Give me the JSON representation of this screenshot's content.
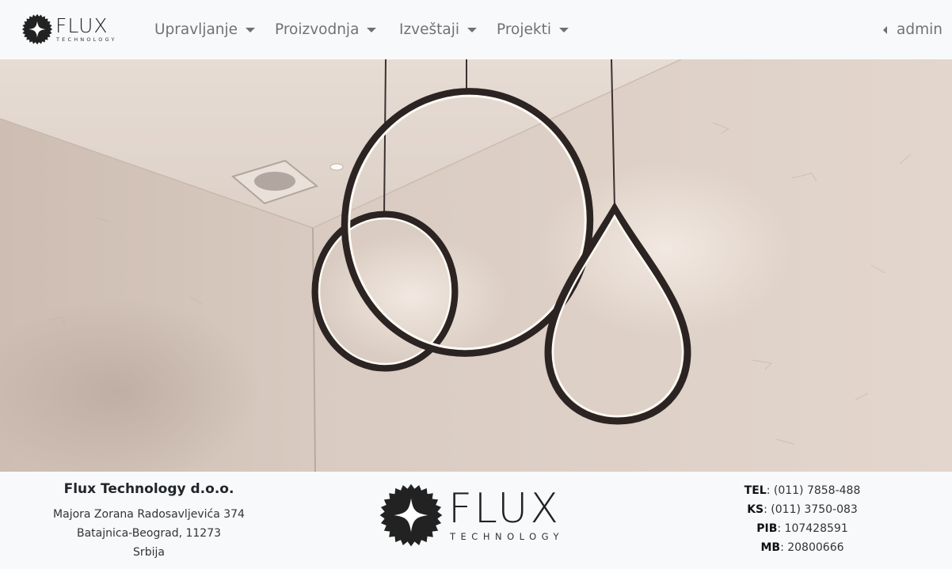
{
  "brand": {
    "name": "FLUX",
    "tagline": "TECHNOLOGY"
  },
  "nav": {
    "items": [
      {
        "label": "Upravljanje"
      },
      {
        "label": "Proizvodnja"
      },
      {
        "label": "Izveštaji"
      },
      {
        "label": "Projekti"
      }
    ],
    "user": "admin"
  },
  "footer": {
    "company": {
      "name": "Flux Technology d.o.o.",
      "address_line1": "Majora Zorana Radosavljevića 374",
      "address_line2": "Batajnica-Beograd, 11273",
      "country": "Srbija"
    },
    "logo": {
      "name": "FLUX",
      "tagline": "TECHNOLOGY"
    },
    "contact": {
      "tel_label": "TEL",
      "tel_value": ": (011) 7858-488",
      "ks_label": "KS",
      "ks_value": ": (011) 3750-083",
      "pib_label": "PIB",
      "pib_value": ": 107428591",
      "mb_label": "MB",
      "mb_value": ": 20800666"
    }
  },
  "colors": {
    "navbar_bg": "#f8f9fa",
    "nav_text": "#7a7a7a",
    "wall": "#d9cbc0"
  },
  "icons": [
    "flux-logo-icon",
    "caret-down-icon",
    "caret-left-icon"
  ]
}
